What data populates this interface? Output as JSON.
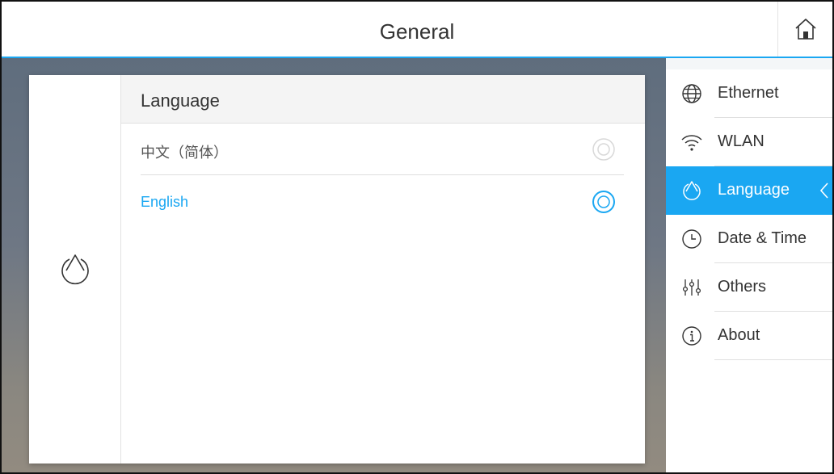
{
  "header": {
    "title": "General",
    "home_icon": "home-icon"
  },
  "card": {
    "title": "Language",
    "section_icon": "language-icon",
    "options": [
      {
        "label": "中文（简体）",
        "selected": false
      },
      {
        "label": "English",
        "selected": true
      }
    ]
  },
  "sidebar": {
    "items": [
      {
        "label": "Ethernet",
        "icon": "globe-icon",
        "active": false
      },
      {
        "label": "WLAN",
        "icon": "wifi-icon",
        "active": false
      },
      {
        "label": "Language",
        "icon": "language-icon",
        "active": true
      },
      {
        "label": "Date & Time",
        "icon": "clock-icon",
        "active": false
      },
      {
        "label": "Others",
        "icon": "sliders-icon",
        "active": false
      },
      {
        "label": "About",
        "icon": "info-icon",
        "active": false
      }
    ]
  },
  "colors": {
    "accent": "#1aa7f2",
    "text": "#333333",
    "muted": "#555555"
  }
}
